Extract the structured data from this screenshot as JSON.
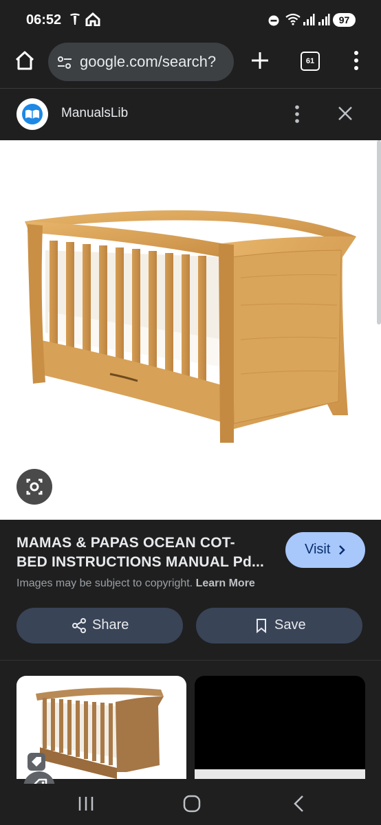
{
  "status_bar": {
    "time": "06:52",
    "battery": "97"
  },
  "browser": {
    "url": "google.com/search?",
    "tab_count": "61"
  },
  "site": {
    "name": "ManualsLib"
  },
  "result": {
    "title_line1": "MAMAS & PAPAS OCEAN COT-",
    "title_line2": "BED INSTRUCTIONS MANUAL Pd...",
    "visit_label": "Visit",
    "copyright_text": "Images may be subject to copyright.",
    "learn_more": "Learn More",
    "share_label": "Share",
    "save_label": "Save"
  },
  "colors": {
    "accent": "#a8c7fa",
    "pill": "#394457",
    "background": "#1f1f1f",
    "wood": "#d9a55a"
  }
}
